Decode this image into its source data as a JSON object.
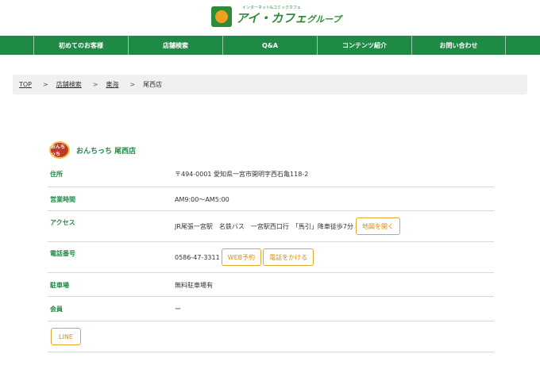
{
  "brand": {
    "tagline": "インターネット&コミックカフェ",
    "name": "アイ・カフェ",
    "suffix": "グループ",
    "color_primary": "#1f8a46",
    "color_accent": "#e3a52a"
  },
  "nav": {
    "items": [
      {
        "label": "初めてのお客様"
      },
      {
        "label": "店舗検索"
      },
      {
        "label": "Q&A"
      },
      {
        "label": "コンテンツ紹介"
      },
      {
        "label": "お問い合わせ"
      }
    ]
  },
  "breadcrumb": {
    "top": "TOP",
    "search": "店舗検索",
    "region": "東海",
    "current": "尾西店",
    "separator": ">"
  },
  "store": {
    "logo_text": "おんちっち",
    "name": "おんちっち 尾西店"
  },
  "info": {
    "address_label": "住所",
    "address_value": "〒494-0001 愛知県一宮市開明字西石亀118-2",
    "hours_label": "営業時間",
    "hours_value": "AM9:00〜AM5:00",
    "access_label": "アクセス",
    "access_value": "JR尾張一宮駅　名鉄バス　一宮駅西口行　「馬引」降車徒歩7分",
    "map_button": "地図を開く",
    "phone_label": "電話番号",
    "phone_value": "0586-47-3311",
    "web_reserve_button": "WEB予約",
    "call_button": "電話をかける",
    "parking_label": "駐車場",
    "parking_value": "無料駐車場有",
    "member_label": "会員",
    "member_value": "ー",
    "line_button": "LINE"
  }
}
